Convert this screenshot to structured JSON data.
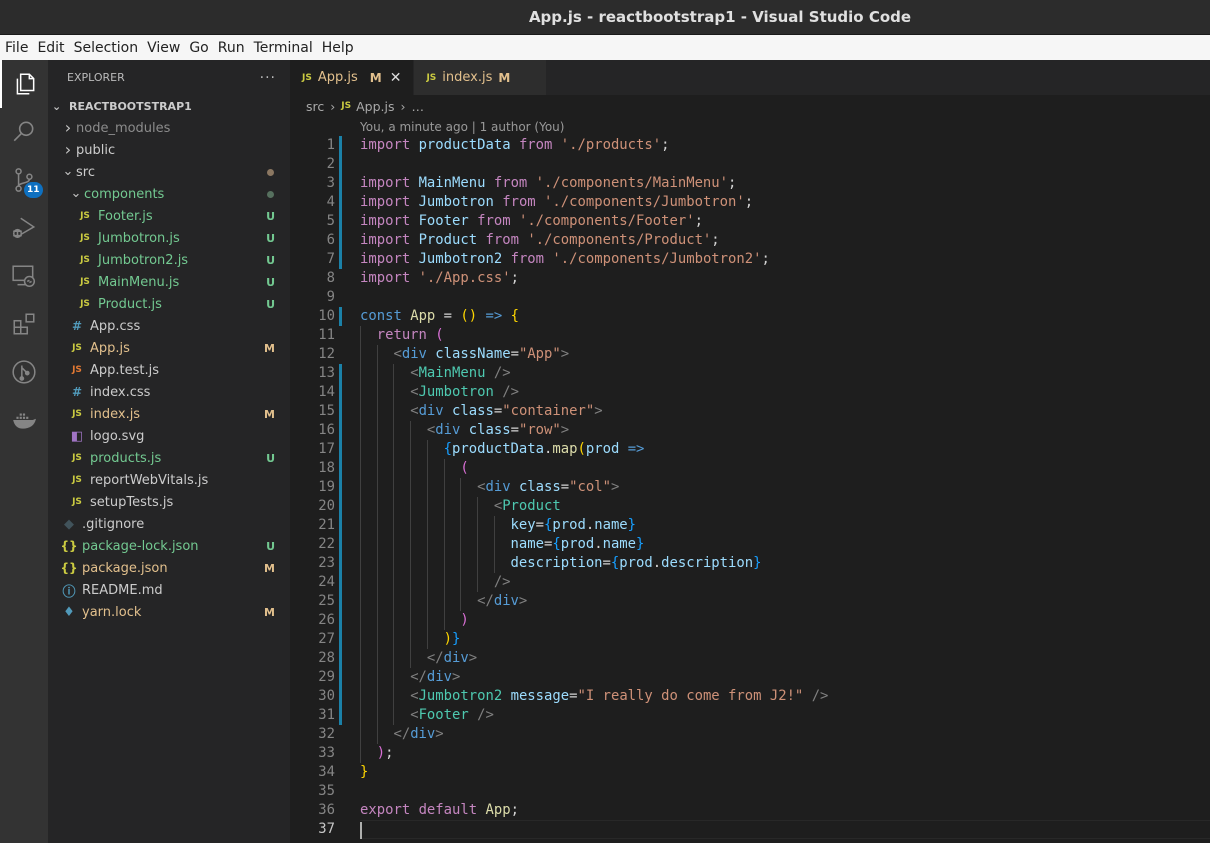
{
  "window": {
    "title": "App.js - reactbootstrap1 - Visual Studio Code"
  },
  "menu": [
    "File",
    "Edit",
    "Selection",
    "View",
    "Go",
    "Run",
    "Terminal",
    "Help"
  ],
  "activity_bar": {
    "items": [
      {
        "name": "explorer-icon",
        "active": true
      },
      {
        "name": "search-icon"
      },
      {
        "name": "source-control-icon",
        "badge": "11"
      },
      {
        "name": "run-debug-icon"
      },
      {
        "name": "remote-explorer-icon"
      },
      {
        "name": "extensions-icon"
      },
      {
        "name": "gitlens-icon"
      },
      {
        "name": "docker-icon"
      }
    ]
  },
  "explorer": {
    "title": "EXPLORER",
    "more": "···",
    "root": "REACTBOOTSTRAP1",
    "colors": {
      "untracked": "#73c991",
      "modified": "#e2c08d",
      "js_icon": "#cbcb41",
      "css_icon": "#519aba"
    },
    "tree": [
      {
        "label": "node_modules",
        "type": "folder",
        "open": false,
        "depth": 1,
        "dim": true
      },
      {
        "label": "public",
        "type": "folder",
        "open": false,
        "depth": 1
      },
      {
        "label": "src",
        "type": "folder",
        "open": true,
        "depth": 1,
        "dot": "#8b7761"
      },
      {
        "label": "components",
        "type": "folder",
        "open": true,
        "depth": 2,
        "status": "untracked",
        "dot": "#56705e"
      },
      {
        "label": "Footer.js",
        "type": "js",
        "depth": 3,
        "status": "untracked",
        "deco": "U"
      },
      {
        "label": "Jumbotron.js",
        "type": "js",
        "depth": 3,
        "status": "untracked",
        "deco": "U"
      },
      {
        "label": "Jumbotron2.js",
        "type": "js",
        "depth": 3,
        "status": "untracked",
        "deco": "U"
      },
      {
        "label": "MainMenu.js",
        "type": "js",
        "depth": 3,
        "status": "untracked",
        "deco": "U"
      },
      {
        "label": "Product.js",
        "type": "js",
        "depth": 3,
        "status": "untracked",
        "deco": "U"
      },
      {
        "label": "App.css",
        "type": "css",
        "depth": 2
      },
      {
        "label": "App.js",
        "type": "js",
        "depth": 2,
        "status": "modified",
        "deco": "M"
      },
      {
        "label": "App.test.js",
        "type": "test",
        "depth": 2
      },
      {
        "label": "index.css",
        "type": "css",
        "depth": 2
      },
      {
        "label": "index.js",
        "type": "js",
        "depth": 2,
        "status": "modified",
        "deco": "M"
      },
      {
        "label": "logo.svg",
        "type": "svg",
        "depth": 2
      },
      {
        "label": "products.js",
        "type": "js",
        "depth": 2,
        "status": "untracked",
        "deco": "U"
      },
      {
        "label": "reportWebVitals.js",
        "type": "js",
        "depth": 2
      },
      {
        "label": "setupTests.js",
        "type": "js",
        "depth": 2
      },
      {
        "label": ".gitignore",
        "type": "git",
        "depth": 1
      },
      {
        "label": "package-lock.json",
        "type": "json",
        "depth": 1,
        "status": "untracked",
        "deco": "U"
      },
      {
        "label": "package.json",
        "type": "json",
        "depth": 1,
        "status": "modified",
        "deco": "M"
      },
      {
        "label": "README.md",
        "type": "info",
        "depth": 1
      },
      {
        "label": "yarn.lock",
        "type": "yarn",
        "depth": 1,
        "status": "modified",
        "deco": "M"
      }
    ]
  },
  "tabs": [
    {
      "label": "App.js",
      "icon": "JS",
      "status": "M",
      "active": true,
      "close": "✕"
    },
    {
      "label": "index.js",
      "icon": "JS",
      "status": "M",
      "active": false
    }
  ],
  "breadcrumb": {
    "folder": "src",
    "file": "App.js",
    "icon": "JS",
    "more": "…"
  },
  "codelens": "You, a minute ago | 1 author (You)",
  "editor": {
    "current_line": 37,
    "lines": [
      {
        "n": 1,
        "git": true,
        "t": [
          [
            "kw",
            "import"
          ],
          [
            "plain",
            " "
          ],
          [
            "var",
            "productData"
          ],
          [
            "plain",
            " "
          ],
          [
            "kw",
            "from"
          ],
          [
            "plain",
            " "
          ],
          [
            "str",
            "'./products'"
          ],
          [
            "plain",
            ";"
          ]
        ]
      },
      {
        "n": 2,
        "git": true,
        "t": []
      },
      {
        "n": 3,
        "git": true,
        "t": [
          [
            "kw",
            "import"
          ],
          [
            "plain",
            " "
          ],
          [
            "var",
            "MainMenu"
          ],
          [
            "plain",
            " "
          ],
          [
            "kw",
            "from"
          ],
          [
            "plain",
            " "
          ],
          [
            "str",
            "'./components/MainMenu'"
          ],
          [
            "plain",
            ";"
          ]
        ]
      },
      {
        "n": 4,
        "git": true,
        "t": [
          [
            "kw",
            "import"
          ],
          [
            "plain",
            " "
          ],
          [
            "var",
            "Jumbotron"
          ],
          [
            "plain",
            " "
          ],
          [
            "kw",
            "from"
          ],
          [
            "plain",
            " "
          ],
          [
            "str",
            "'./components/Jumbotron'"
          ],
          [
            "plain",
            ";"
          ]
        ]
      },
      {
        "n": 5,
        "git": true,
        "t": [
          [
            "kw",
            "import"
          ],
          [
            "plain",
            " "
          ],
          [
            "var",
            "Footer"
          ],
          [
            "plain",
            " "
          ],
          [
            "kw",
            "from"
          ],
          [
            "plain",
            " "
          ],
          [
            "str",
            "'./components/Footer'"
          ],
          [
            "plain",
            ";"
          ]
        ]
      },
      {
        "n": 6,
        "git": true,
        "t": [
          [
            "kw",
            "import"
          ],
          [
            "plain",
            " "
          ],
          [
            "var",
            "Product"
          ],
          [
            "plain",
            " "
          ],
          [
            "kw",
            "from"
          ],
          [
            "plain",
            " "
          ],
          [
            "str",
            "'./components/Product'"
          ],
          [
            "plain",
            ";"
          ]
        ]
      },
      {
        "n": 7,
        "git": true,
        "t": [
          [
            "kw",
            "import"
          ],
          [
            "plain",
            " "
          ],
          [
            "var",
            "Jumbotron2"
          ],
          [
            "plain",
            " "
          ],
          [
            "kw",
            "from"
          ],
          [
            "plain",
            " "
          ],
          [
            "str",
            "'./components/Jumbotron2'"
          ],
          [
            "plain",
            ";"
          ]
        ]
      },
      {
        "n": 8,
        "t": [
          [
            "kw",
            "import"
          ],
          [
            "plain",
            " "
          ],
          [
            "str",
            "'./App.css'"
          ],
          [
            "plain",
            ";"
          ]
        ]
      },
      {
        "n": 9,
        "t": []
      },
      {
        "n": 10,
        "git": true,
        "t": [
          [
            "kw2",
            "const"
          ],
          [
            "plain",
            " "
          ],
          [
            "fn",
            "App"
          ],
          [
            "plain",
            " = "
          ],
          [
            "br1",
            "()"
          ],
          [
            "plain",
            " "
          ],
          [
            "kw2",
            "=>"
          ],
          [
            "plain",
            " "
          ],
          [
            "br1",
            "{"
          ]
        ]
      },
      {
        "n": 11,
        "indent": 1,
        "t": [
          [
            "kw",
            "return"
          ],
          [
            "plain",
            " "
          ],
          [
            "br2",
            "("
          ]
        ]
      },
      {
        "n": 12,
        "indent": 2,
        "t": [
          [
            "punc",
            "<"
          ],
          [
            "tag",
            "div"
          ],
          [
            "plain",
            " "
          ],
          [
            "attr",
            "className"
          ],
          [
            "plain",
            "="
          ],
          [
            "str",
            "\"App\""
          ],
          [
            "punc",
            ">"
          ]
        ]
      },
      {
        "n": 13,
        "indent": 3,
        "git": true,
        "t": [
          [
            "punc",
            "<"
          ],
          [
            "comp",
            "MainMenu"
          ],
          [
            "plain",
            " "
          ],
          [
            "punc",
            "/>"
          ]
        ]
      },
      {
        "n": 14,
        "indent": 3,
        "git": true,
        "t": [
          [
            "punc",
            "<"
          ],
          [
            "comp",
            "Jumbotron"
          ],
          [
            "plain",
            " "
          ],
          [
            "punc",
            "/>"
          ]
        ]
      },
      {
        "n": 15,
        "indent": 3,
        "git": true,
        "t": [
          [
            "punc",
            "<"
          ],
          [
            "tag",
            "div"
          ],
          [
            "plain",
            " "
          ],
          [
            "attr",
            "class"
          ],
          [
            "plain",
            "="
          ],
          [
            "str",
            "\"container\""
          ],
          [
            "punc",
            ">"
          ]
        ]
      },
      {
        "n": 16,
        "indent": 4,
        "git": true,
        "t": [
          [
            "punc",
            "<"
          ],
          [
            "tag",
            "div"
          ],
          [
            "plain",
            " "
          ],
          [
            "attr",
            "class"
          ],
          [
            "plain",
            "="
          ],
          [
            "str",
            "\"row\""
          ],
          [
            "punc",
            ">"
          ]
        ]
      },
      {
        "n": 17,
        "indent": 5,
        "git": true,
        "t": [
          [
            "br3",
            "{"
          ],
          [
            "var",
            "productData"
          ],
          [
            "plain",
            "."
          ],
          [
            "fn",
            "map"
          ],
          [
            "br1",
            "("
          ],
          [
            "var",
            "prod"
          ],
          [
            "plain",
            " "
          ],
          [
            "kw2",
            "=>"
          ]
        ]
      },
      {
        "n": 18,
        "indent": 6,
        "git": true,
        "t": [
          [
            "br2",
            "("
          ]
        ]
      },
      {
        "n": 19,
        "indent": 7,
        "git": true,
        "t": [
          [
            "punc",
            "<"
          ],
          [
            "tag",
            "div"
          ],
          [
            "plain",
            " "
          ],
          [
            "attr",
            "class"
          ],
          [
            "plain",
            "="
          ],
          [
            "str",
            "\"col\""
          ],
          [
            "punc",
            ">"
          ]
        ]
      },
      {
        "n": 20,
        "indent": 8,
        "git": true,
        "t": [
          [
            "punc",
            "<"
          ],
          [
            "comp",
            "Product"
          ]
        ]
      },
      {
        "n": 21,
        "indent": 9,
        "git": true,
        "t": [
          [
            "attr",
            "key"
          ],
          [
            "plain",
            "="
          ],
          [
            "br3",
            "{"
          ],
          [
            "var",
            "prod"
          ],
          [
            "plain",
            "."
          ],
          [
            "var",
            "name"
          ],
          [
            "br3",
            "}"
          ]
        ]
      },
      {
        "n": 22,
        "indent": 9,
        "git": true,
        "t": [
          [
            "attr",
            "name"
          ],
          [
            "plain",
            "="
          ],
          [
            "br3",
            "{"
          ],
          [
            "var",
            "prod"
          ],
          [
            "plain",
            "."
          ],
          [
            "var",
            "name"
          ],
          [
            "br3",
            "}"
          ]
        ]
      },
      {
        "n": 23,
        "indent": 9,
        "git": true,
        "t": [
          [
            "attr",
            "description"
          ],
          [
            "plain",
            "="
          ],
          [
            "br3",
            "{"
          ],
          [
            "var",
            "prod"
          ],
          [
            "plain",
            "."
          ],
          [
            "var",
            "description"
          ],
          [
            "br3",
            "}"
          ]
        ]
      },
      {
        "n": 24,
        "indent": 8,
        "git": true,
        "t": [
          [
            "punc",
            "/>"
          ]
        ]
      },
      {
        "n": 25,
        "indent": 7,
        "git": true,
        "t": [
          [
            "punc",
            "</"
          ],
          [
            "tag",
            "div"
          ],
          [
            "punc",
            ">"
          ]
        ]
      },
      {
        "n": 26,
        "indent": 6,
        "git": true,
        "t": [
          [
            "br2",
            ")"
          ]
        ]
      },
      {
        "n": 27,
        "indent": 5,
        "git": true,
        "t": [
          [
            "br1",
            ")"
          ],
          [
            "br3",
            "}"
          ]
        ]
      },
      {
        "n": 28,
        "indent": 4,
        "git": true,
        "t": [
          [
            "punc",
            "</"
          ],
          [
            "tag",
            "div"
          ],
          [
            "punc",
            ">"
          ]
        ]
      },
      {
        "n": 29,
        "indent": 3,
        "git": true,
        "t": [
          [
            "punc",
            "</"
          ],
          [
            "tag",
            "div"
          ],
          [
            "punc",
            ">"
          ]
        ]
      },
      {
        "n": 30,
        "indent": 3,
        "git": true,
        "t": [
          [
            "punc",
            "<"
          ],
          [
            "comp",
            "Jumbotron2"
          ],
          [
            "plain",
            " "
          ],
          [
            "attr",
            "message"
          ],
          [
            "plain",
            "="
          ],
          [
            "str",
            "\"I really do come from J2!\""
          ],
          [
            "plain",
            " "
          ],
          [
            "punc",
            "/>"
          ]
        ]
      },
      {
        "n": 31,
        "indent": 3,
        "git": true,
        "t": [
          [
            "punc",
            "<"
          ],
          [
            "comp",
            "Footer"
          ],
          [
            "plain",
            " "
          ],
          [
            "punc",
            "/>"
          ]
        ]
      },
      {
        "n": 32,
        "indent": 2,
        "t": [
          [
            "punc",
            "</"
          ],
          [
            "tag",
            "div"
          ],
          [
            "punc",
            ">"
          ]
        ]
      },
      {
        "n": 33,
        "indent": 1,
        "t": [
          [
            "br2",
            ")"
          ],
          [
            "plain",
            ";"
          ]
        ]
      },
      {
        "n": 34,
        "t": [
          [
            "br1",
            "}"
          ]
        ]
      },
      {
        "n": 35,
        "t": []
      },
      {
        "n": 36,
        "t": [
          [
            "kw",
            "export"
          ],
          [
            "plain",
            " "
          ],
          [
            "kw",
            "default"
          ],
          [
            "plain",
            " "
          ],
          [
            "fn",
            "App"
          ],
          [
            "plain",
            ";"
          ]
        ]
      },
      {
        "n": 37,
        "t": [],
        "cursor": true
      }
    ]
  }
}
